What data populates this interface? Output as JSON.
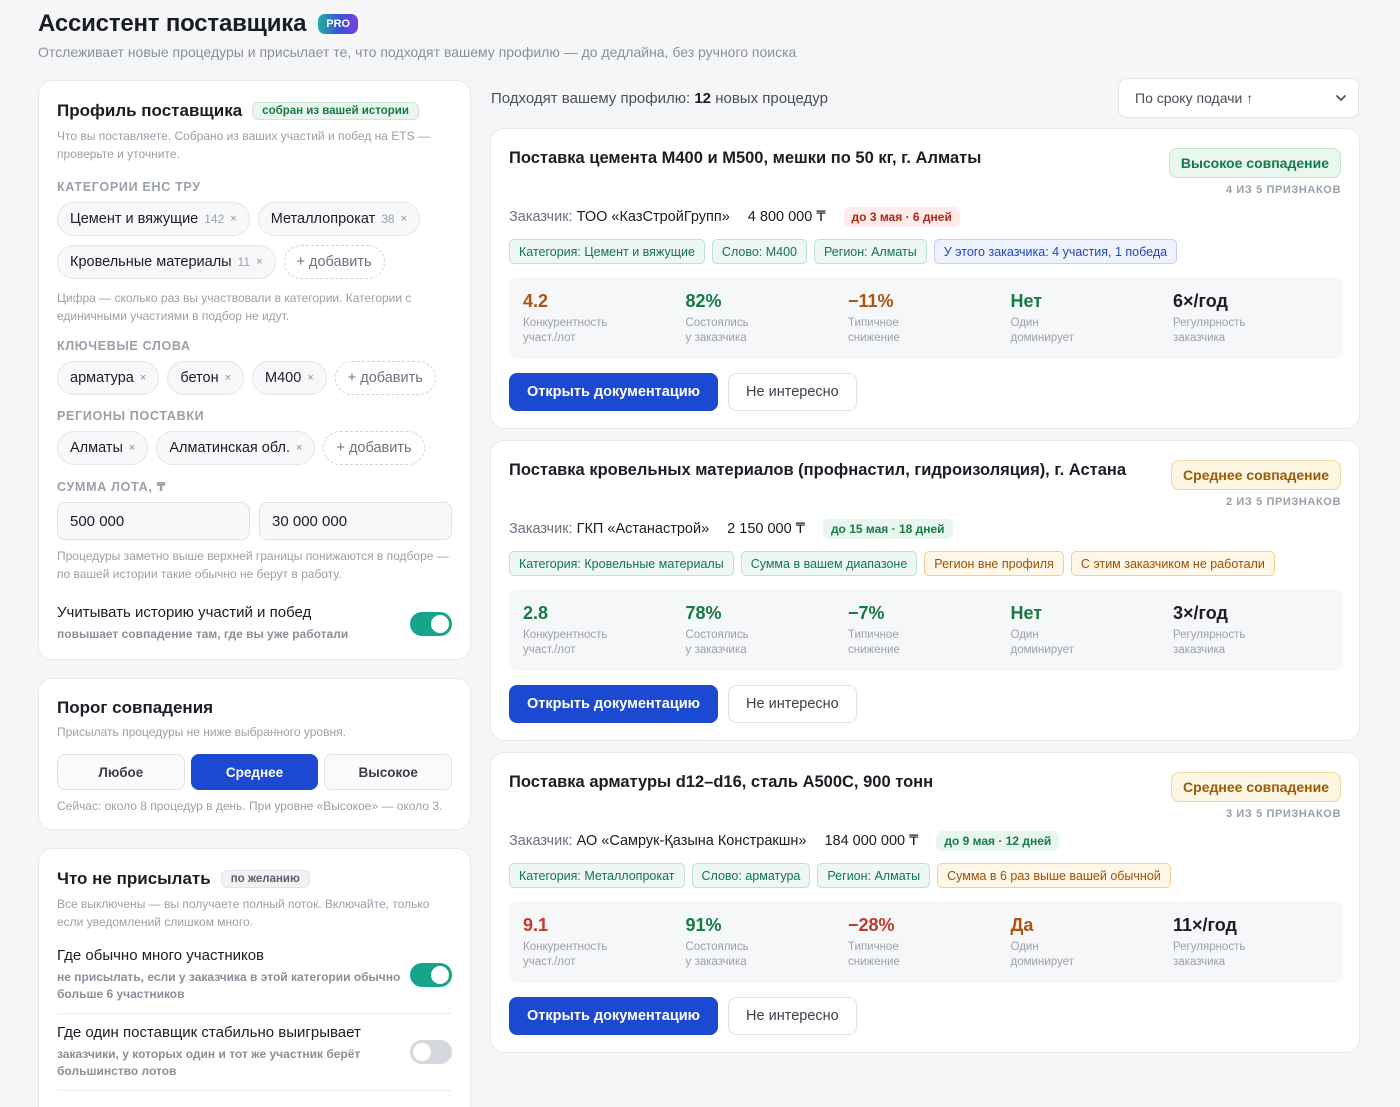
{
  "header": {
    "title": "Ассистент поставщика",
    "badge": "PRO",
    "subtitle": "Отслеживает новые процедуры и присылает те, что подходят вашему профилю — до дедлайна, без ручного поиска"
  },
  "profile": {
    "title": "Профиль поставщика",
    "tag": "собран из вашей истории",
    "hint": "Что вы поставляете. Собрано из ваших участий и побед на ETS — проверьте и уточните.",
    "categories_label": "КАТЕГОРИИ ЕНС ТРУ",
    "categories": [
      {
        "name": "Цемент и вяжущие",
        "count": "142"
      },
      {
        "name": "Металлопрокат",
        "count": "38"
      },
      {
        "name": "Кровельные материалы",
        "count": "11"
      }
    ],
    "add_label": "+ добавить",
    "remove_glyph": "×",
    "categories_hint": "Цифра — сколько раз вы участвовали в категории. Категории с единичными участиями в подбор не идут.",
    "keywords_label": "КЛЮЧЕВЫЕ СЛОВА",
    "keywords": [
      "арматура",
      "бетон",
      "М400"
    ],
    "regions_label": "РЕГИОНЫ ПОСТАВКИ",
    "regions": [
      "Алматы",
      "Алматинская обл."
    ],
    "sum_label": "СУММА ЛОТА, ₸",
    "sum_min": "500 000",
    "sum_max": "30 000 000",
    "sum_hint": "Процедуры заметно выше верхней границы понижаются в подборе — по вашей истории такие обычно не берут в работу.",
    "history_title": "Учитывать историю участий и побед",
    "history_sub": "повышает совпадение там, где вы уже работали",
    "history_on": true
  },
  "threshold": {
    "title": "Порог совпадения",
    "hint": "Присылать процедуры не ниже выбранного уровня.",
    "options": [
      "Любое",
      "Среднее",
      "Высокое"
    ],
    "selected": "Среднее",
    "note": "Сейчас: около 8 процедур в день. При уровне «Высокое» — около 3."
  },
  "exclude": {
    "title": "Что не присылать",
    "tag": "по желанию",
    "hint": "Все выключены — вы получаете полный поток. Включайте, только если уведомлений слишком много.",
    "items": [
      {
        "title": "Где обычно много участников",
        "sub": "не присылать, если у заказчика в этой категории обычно больше 6 участников",
        "on": true
      },
      {
        "title": "Где один поставщик стабильно выигрывает",
        "sub": "заказчики, у которых один и тот же участник берёт большинство лотов",
        "on": false
      }
    ]
  },
  "results": {
    "count_prefix": "Подходят вашему профилю:",
    "count": "12",
    "count_suffix": "новых процедур",
    "sort": "По сроку подачи ↑",
    "customer_label": "Заказчик:",
    "open_label": "Открыть документацию",
    "dismiss_label": "Не интересно",
    "metric_labels": [
      [
        "Конкурентность",
        "участ./лот"
      ],
      [
        "Состоялись",
        "у заказчика"
      ],
      [
        "Типичное",
        "снижение"
      ],
      [
        "Один",
        "доминирует"
      ],
      [
        "Регулярность",
        "заказчика"
      ]
    ],
    "cards": [
      {
        "title": "Поставка цемента М400 и М500, мешки по 50 кг, г. Алматы",
        "match": "Высокое совпадение",
        "match_level": "high",
        "signs": "4 ИЗ 5 ПРИЗНАКОВ",
        "customer": "ТОО «КазСтройГрупп»",
        "amount": "4 800 000 ₸",
        "deadline": "до 3 мая · 6 дней",
        "deadline_tone": "red",
        "tags": [
          {
            "text": "Категория: Цемент и вяжущие",
            "tone": "g"
          },
          {
            "text": "Слово: М400",
            "tone": "g"
          },
          {
            "text": "Регион: Алматы",
            "tone": "g"
          },
          {
            "text": "У этого заказчика: 4 участия, 1 победа",
            "tone": "b"
          }
        ],
        "metrics": [
          {
            "value": "4.2",
            "tone": "brown"
          },
          {
            "value": "82%",
            "tone": "green"
          },
          {
            "value": "−11%",
            "tone": "brown"
          },
          {
            "value": "Нет",
            "tone": "green"
          },
          {
            "value": "6×/год",
            "tone": "dark"
          }
        ]
      },
      {
        "title": "Поставка кровельных материалов (профнастил, гидроизоляция), г. Астана",
        "match": "Среднее совпадение",
        "match_level": "mid",
        "signs": "2 ИЗ 5 ПРИЗНАКОВ",
        "customer": "ГКП «Астанастрой»",
        "amount": "2 150 000 ₸",
        "deadline": "до 15 мая · 18 дней",
        "deadline_tone": "green",
        "tags": [
          {
            "text": "Категория: Кровельные материалы",
            "tone": "g"
          },
          {
            "text": "Сумма в вашем диапазоне",
            "tone": "g"
          },
          {
            "text": "Регион вне профиля",
            "tone": "o"
          },
          {
            "text": "С этим заказчиком не работали",
            "tone": "o"
          }
        ],
        "metrics": [
          {
            "value": "2.8",
            "tone": "green"
          },
          {
            "value": "78%",
            "tone": "green"
          },
          {
            "value": "−7%",
            "tone": "green"
          },
          {
            "value": "Нет",
            "tone": "green"
          },
          {
            "value": "3×/год",
            "tone": "dark"
          }
        ]
      },
      {
        "title": "Поставка арматуры d12–d16, сталь А500С, 900 тонн",
        "match": "Среднее совпадение",
        "match_level": "mid",
        "signs": "3 ИЗ 5 ПРИЗНАКОВ",
        "customer": "АО «Самрук-Қазына Констракшн»",
        "amount": "184 000 000 ₸",
        "deadline": "до 9 мая · 12 дней",
        "deadline_tone": "green",
        "tags": [
          {
            "text": "Категория: Металлопрокат",
            "tone": "g"
          },
          {
            "text": "Слово: арматура",
            "tone": "g"
          },
          {
            "text": "Регион: Алматы",
            "tone": "g"
          },
          {
            "text": "Сумма в 6 раз выше вашей обычной",
            "tone": "o"
          }
        ],
        "metrics": [
          {
            "value": "9.1",
            "tone": "red"
          },
          {
            "value": "91%",
            "tone": "green"
          },
          {
            "value": "−28%",
            "tone": "red"
          },
          {
            "value": "Да",
            "tone": "brown"
          },
          {
            "value": "11×/год",
            "tone": "dark"
          }
        ]
      }
    ]
  }
}
